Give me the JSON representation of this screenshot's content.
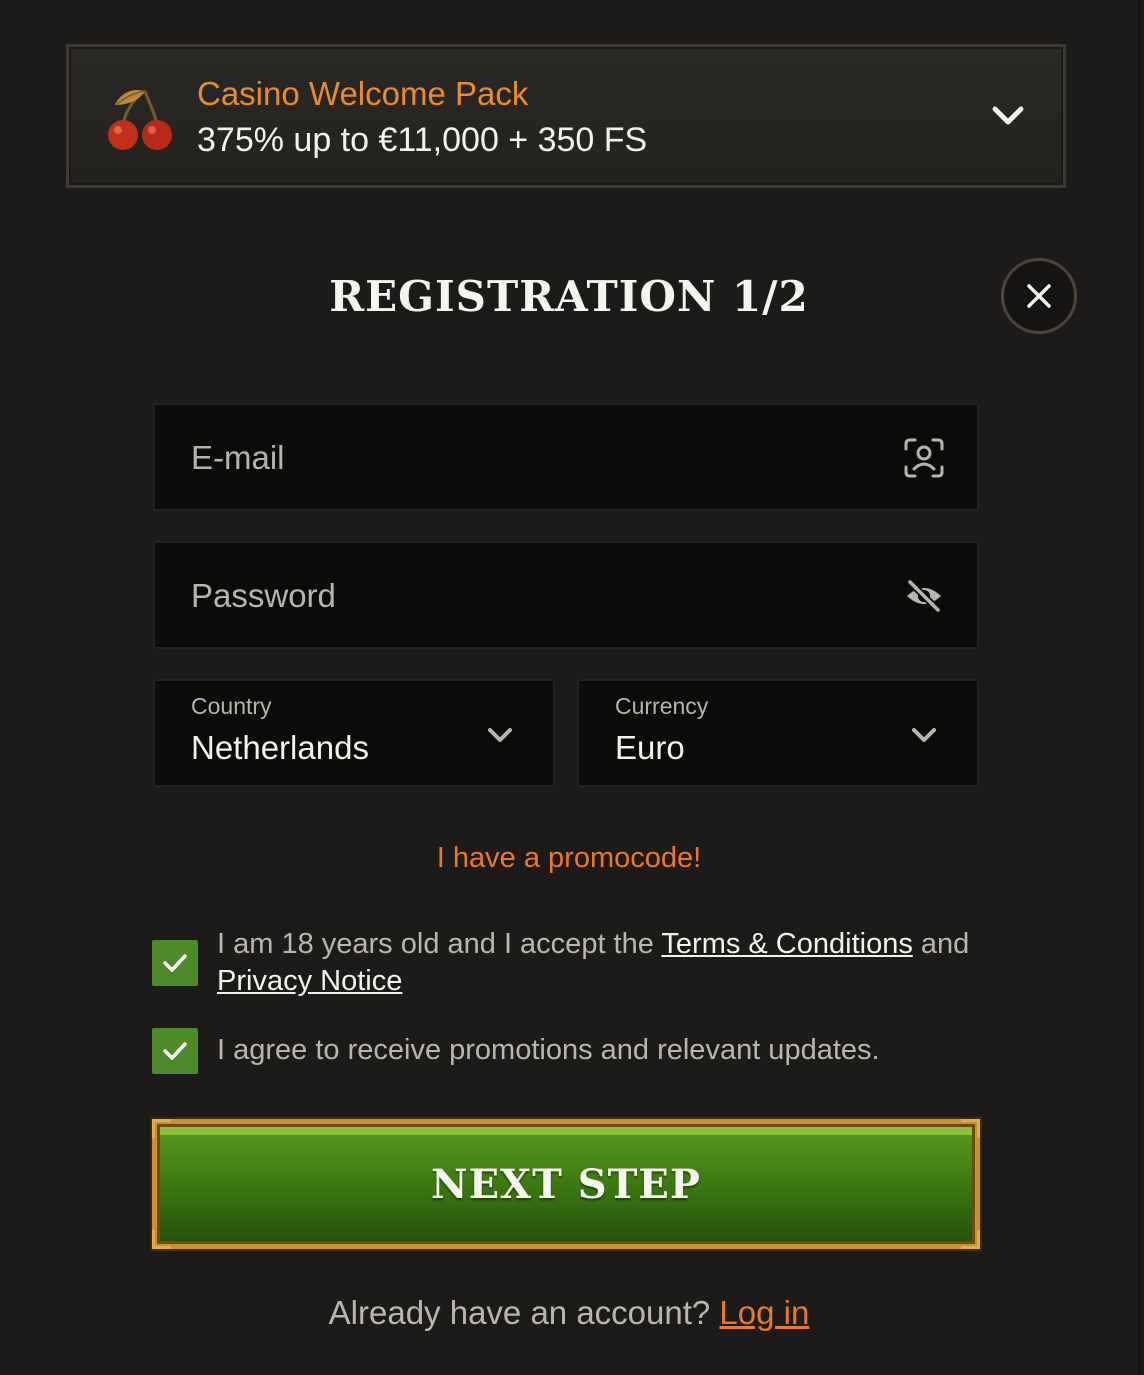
{
  "bonus": {
    "title": "Casino Welcome Pack",
    "offer": "375% up to €11,000 + 350 FS",
    "icon": "cherry-icon",
    "toggle_icon": "chevron-down-icon"
  },
  "registration": {
    "title": "REGISTRATION 1/2",
    "close_icon": "close-icon"
  },
  "form": {
    "email_placeholder": "E-mail",
    "email_icon": "face-scan-icon",
    "password_placeholder": "Password",
    "password_icon": "eye-off-icon",
    "country": {
      "label": "Country",
      "value": "Netherlands"
    },
    "currency": {
      "label": "Currency",
      "value": "Euro"
    },
    "promo_link": "I have a promocode!"
  },
  "consents": {
    "terms": {
      "checked": true,
      "text_before": "I am 18 years old and I accept the ",
      "terms_link": "Terms & Conditions",
      "text_between": " and",
      "privacy_link": "Privacy Notice"
    },
    "promotions": {
      "checked": true,
      "text": "I agree to receive promotions and relevant updates."
    }
  },
  "actions": {
    "next_step": "NEXT STEP"
  },
  "footer": {
    "question": "Already have an account? ",
    "login_link": "Log in"
  },
  "colors": {
    "accent_orange": "#e8792a",
    "check_green": "#4d8a2a",
    "button_green": "#3f7d12",
    "gold_border": "#c8922f"
  }
}
